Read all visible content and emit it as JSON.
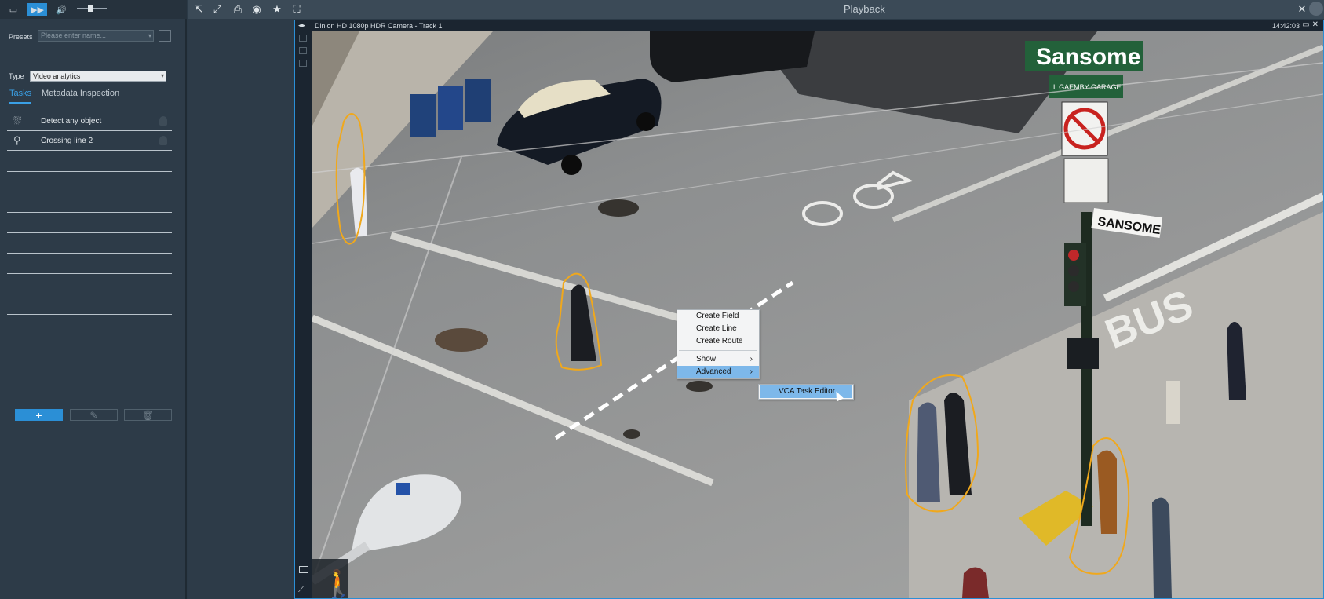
{
  "left_panel": {
    "presets_label": "Presets",
    "presets_placeholder": "Please enter name...",
    "type_label": "Type",
    "type_value": "Video analytics",
    "tabs": [
      {
        "label": "Tasks",
        "active": true
      },
      {
        "label": "Metadata Inspection",
        "active": false
      }
    ],
    "tasks": [
      {
        "label": "Detect any object",
        "icon": "object-detection-icon"
      },
      {
        "label": "Crossing line 2",
        "icon": "crossing-line-icon"
      }
    ],
    "buttons": {
      "add": "+",
      "edit": "✎",
      "delete": "🗑"
    }
  },
  "topbar": {
    "title": "Playback"
  },
  "video": {
    "camera_title": "Dinion HD 1080p HDR Camera - Track 1",
    "timestamp": "14:42:03",
    "scene_signs": {
      "street_sign": "Sansome",
      "street_sign_2": "SANSOME",
      "garage_sign": "L GAEMBY GARAGE",
      "bus_marking": "BUS"
    }
  },
  "context_menu": {
    "items": [
      "Create Field",
      "Create Line",
      "Create Route",
      "Show",
      "Advanced"
    ],
    "submenu": [
      "VCA Task Editor"
    ]
  },
  "colors": {
    "accent": "#2b8fd6",
    "outline": "#f0a81c",
    "menu_highlight": "#7db8ea"
  }
}
